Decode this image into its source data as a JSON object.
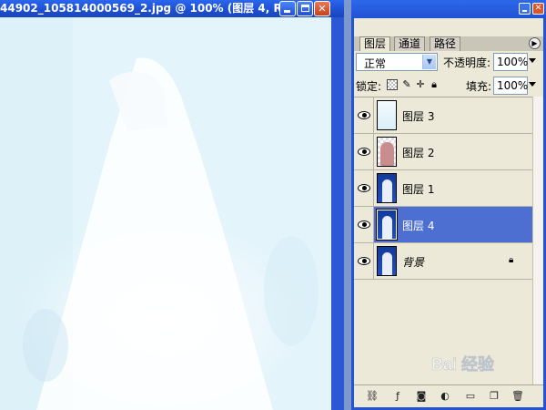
{
  "document": {
    "title": "44902_105814000569_2.jpg @ 100% (图层 4, R..."
  },
  "window_controls": {
    "minimize_icon": "minimize-icon",
    "maximize_icon": "maximize-icon",
    "close_glyph": "✕"
  },
  "palette": {
    "tabs": [
      "图层",
      "通道",
      "路径"
    ],
    "blend_mode": "正常",
    "opacity_label": "不透明度:",
    "opacity_value": "100%",
    "lock_label": "锁定:",
    "fill_label": "填充:",
    "fill_value": "100%",
    "layers": [
      {
        "name": "图层 3",
        "thumb": "light",
        "visible": true,
        "selected": false
      },
      {
        "name": "图层 2",
        "thumb": "pink",
        "visible": true,
        "selected": false
      },
      {
        "name": "图层 1",
        "thumb": "blue",
        "visible": true,
        "selected": false
      },
      {
        "name": "图层 4",
        "thumb": "blue",
        "visible": true,
        "selected": true
      },
      {
        "name": "背景",
        "thumb": "blue",
        "visible": true,
        "selected": false,
        "locked": true
      }
    ]
  },
  "watermark": {
    "text": "Bai 经验"
  },
  "colors": {
    "titlebar": "#1d4fcf",
    "selected_layer": "#4d6fd1",
    "panel_bg": "#ece9d8"
  }
}
